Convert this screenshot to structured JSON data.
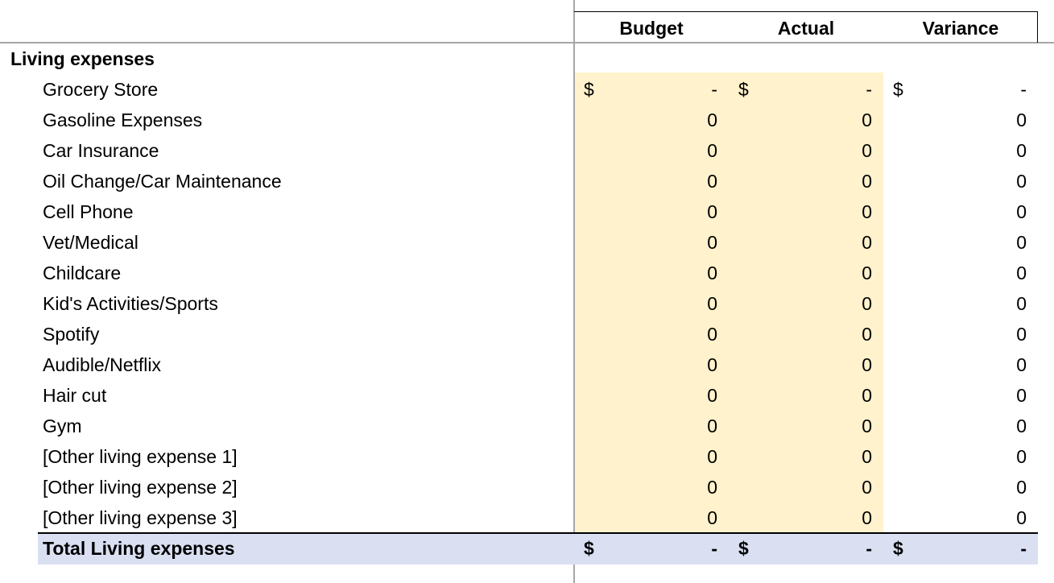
{
  "headers": [
    "Budget",
    "Actual",
    "Variance"
  ],
  "section_title": "Living expenses",
  "currency_symbol": "$",
  "dash": "-",
  "items": [
    {
      "label": "Grocery Store",
      "budget": "-",
      "actual": "-",
      "variance": "-",
      "currency": true
    },
    {
      "label": "Gasoline Expenses",
      "budget": "0",
      "actual": "0",
      "variance": "0"
    },
    {
      "label": "Car Insurance",
      "budget": "0",
      "actual": "0",
      "variance": "0"
    },
    {
      "label": "Oil Change/Car Maintenance",
      "budget": "0",
      "actual": "0",
      "variance": "0"
    },
    {
      "label": "Cell Phone",
      "budget": "0",
      "actual": "0",
      "variance": "0"
    },
    {
      "label": "Vet/Medical",
      "budget": "0",
      "actual": "0",
      "variance": "0"
    },
    {
      "label": "Childcare",
      "budget": "0",
      "actual": "0",
      "variance": "0"
    },
    {
      "label": "Kid's Activities/Sports",
      "budget": "0",
      "actual": "0",
      "variance": "0"
    },
    {
      "label": "Spotify",
      "budget": "0",
      "actual": "0",
      "variance": "0"
    },
    {
      "label": "Audible/Netflix",
      "budget": "0",
      "actual": "0",
      "variance": "0"
    },
    {
      "label": "Hair cut",
      "budget": "0",
      "actual": "0",
      "variance": "0"
    },
    {
      "label": "Gym",
      "budget": "0",
      "actual": "0",
      "variance": "0"
    },
    {
      "label": "[Other living expense 1]",
      "budget": "0",
      "actual": "0",
      "variance": "0"
    },
    {
      "label": "[Other living expense 2]",
      "budget": "0",
      "actual": "0",
      "variance": "0"
    },
    {
      "label": "[Other living expense 3]",
      "budget": "0",
      "actual": "0",
      "variance": "0"
    }
  ],
  "total": {
    "label": "Total Living expenses",
    "budget": "-",
    "actual": "-",
    "variance": "-"
  },
  "colors": {
    "input_fill": "#fff2cc",
    "total_fill": "#dae0f2"
  }
}
